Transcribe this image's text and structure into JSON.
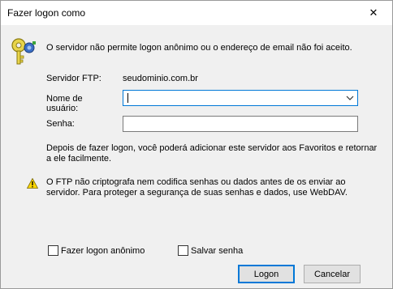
{
  "window": {
    "title": "Fazer logon como",
    "close_glyph": "✕"
  },
  "header": {
    "icon": "key-icon",
    "message": "O servidor não permite logon anônimo ou o endereço de email não foi aceito."
  },
  "server": {
    "label": "Servidor FTP:",
    "value": "seudominio.com.br"
  },
  "username": {
    "label_line1": "Nome de",
    "label_line2": "usuário:",
    "value": ""
  },
  "password": {
    "label": "Senha:",
    "value": ""
  },
  "info": {
    "line1": "Depois de fazer logon, você poderá adicionar este servidor aos Favoritos e retornar",
    "line2": "a ele facilmente."
  },
  "warning": {
    "icon": "warning-icon",
    "line1": "O FTP não criptografa nem codifica senhas ou dados antes de os enviar ao",
    "line2": "servidor. Para proteger a segurança de suas senhas e dados, use WebDAV."
  },
  "options": {
    "anonymous_label": "Fazer logon anônimo",
    "anonymous_checked": false,
    "save_password_label": "Salvar senha",
    "save_password_checked": false
  },
  "buttons": {
    "logon": "Logon",
    "cancel": "Cancelar"
  },
  "colors": {
    "focus_border": "#0078d7",
    "dialog_bg": "#f0f0f0",
    "warning_yellow": "#ffd800",
    "key_gold": "#e8d44a"
  }
}
